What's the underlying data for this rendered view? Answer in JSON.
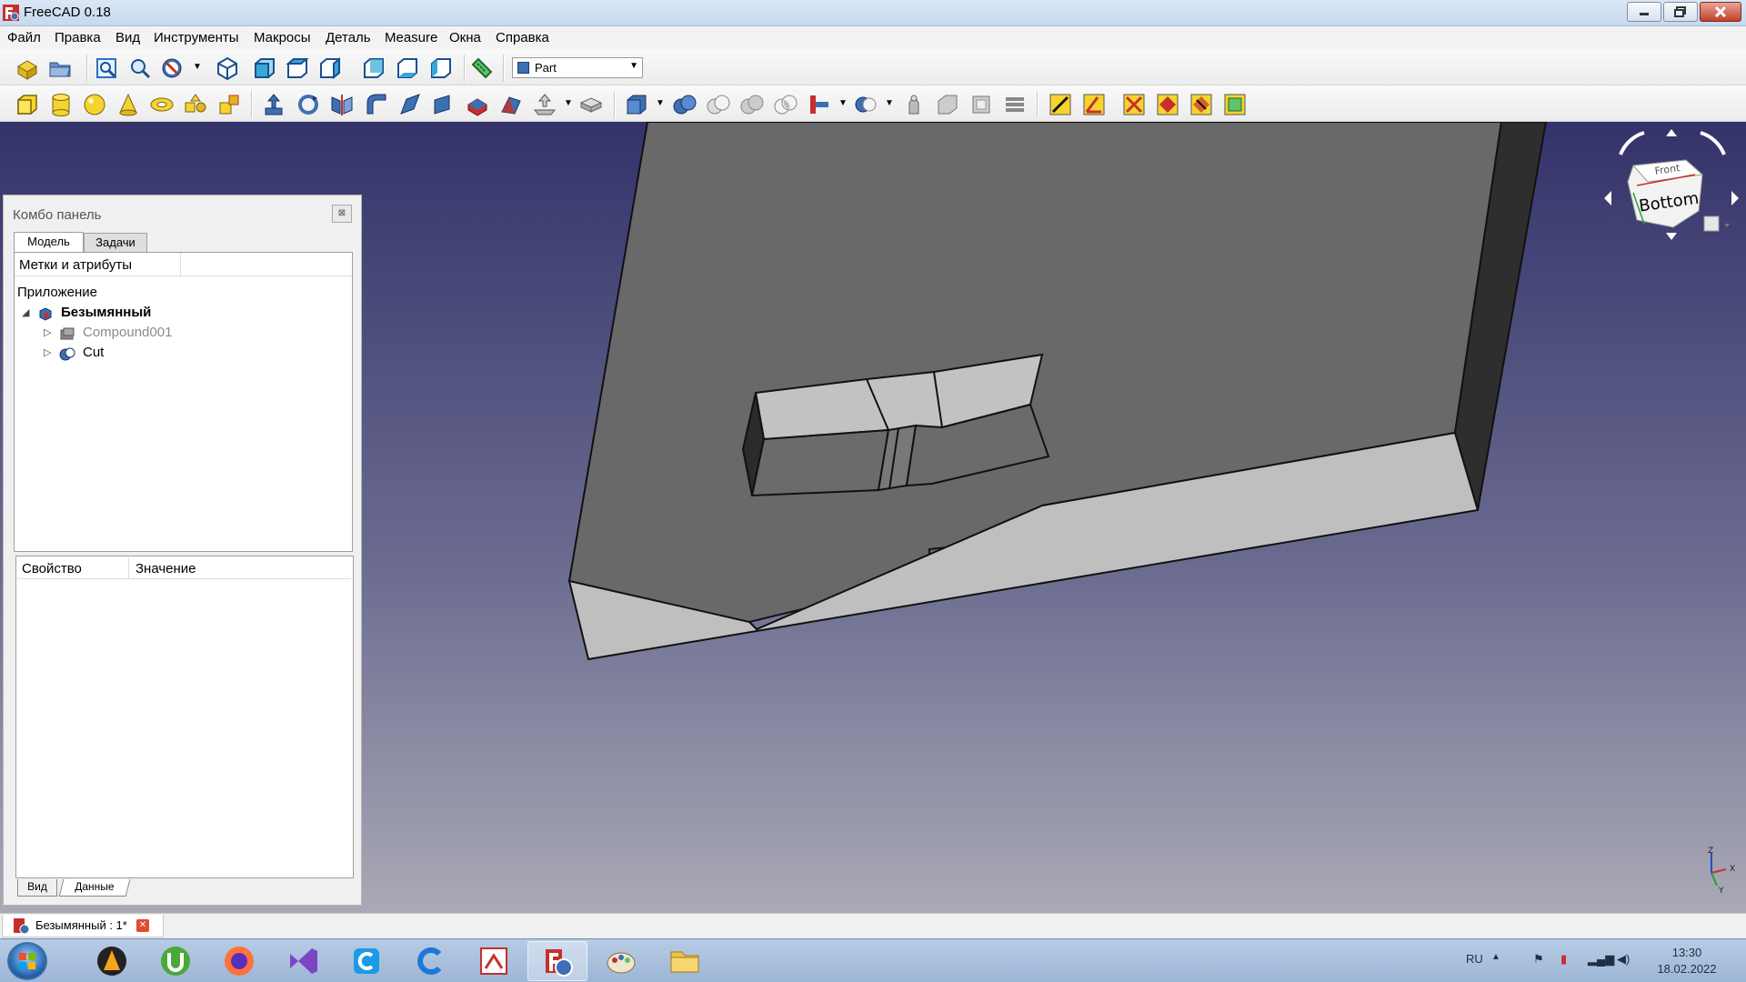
{
  "window": {
    "title": "FreeCAD 0.18"
  },
  "menu": [
    "Файл",
    "Правка",
    "Вид",
    "Инструменты",
    "Макросы",
    "Деталь",
    "Measure",
    "Окна",
    "Справка"
  ],
  "workbench": {
    "selected": "Part"
  },
  "combo_panel": {
    "title": "Комбо панель",
    "tabs": [
      "Модель",
      "Задачи"
    ],
    "tree_header": "Метки и атрибуты",
    "tree_root": "Приложение",
    "document": "Безымянный",
    "objects": [
      "Compound001",
      "Cut"
    ],
    "property_columns": [
      "Свойство",
      "Значение"
    ],
    "bottom_tabs": [
      "Вид",
      "Данные"
    ]
  },
  "navcube": {
    "face": "Bottom",
    "edge": "Front"
  },
  "axes": {
    "x": "X",
    "y": "Y",
    "z": "Z"
  },
  "document_tab": {
    "label": "Безымянный : 1*"
  },
  "taskbar": {
    "lang": "RU",
    "time": "13:30",
    "date": "18.02.2022"
  },
  "colors": {
    "viewport_top": "#33336a",
    "viewport_bottom": "#a9a9b6",
    "accent": "#3d6fb3"
  }
}
